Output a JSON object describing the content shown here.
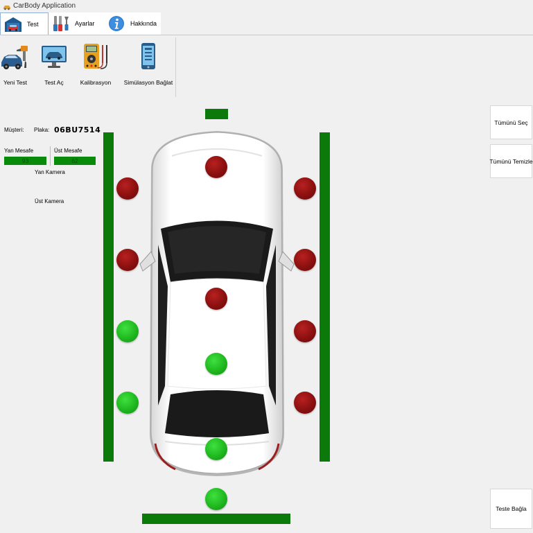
{
  "window": {
    "title": "CarBody Application"
  },
  "tabs": [
    {
      "label": "Test",
      "icon": "garage-icon",
      "active": true
    },
    {
      "label": "Ayarlar",
      "icon": "tools-icon"
    },
    {
      "label": "Hakkında",
      "icon": "info-icon"
    }
  ],
  "toolbar": [
    {
      "label": "Yeni Test",
      "icon": "car-paint-gun-icon"
    },
    {
      "label": "Test Aç",
      "icon": "monitor-car-icon"
    },
    {
      "label": "Kalibrasyon",
      "icon": "multimeter-icon"
    },
    {
      "label": "Simülasyon Bağlat",
      "icon": "smartphone-icon"
    }
  ],
  "info": {
    "customer_label": "Müşteri:",
    "customer_value": "",
    "plate_label": "Plaka:",
    "plate_value": "06BU7514",
    "side_distance_label": "Yan Mesafe",
    "side_distance_value": "93",
    "top_distance_label": "Üst Mesafe",
    "top_distance_value": "62",
    "side_camera_label": "Yan Kamera",
    "top_camera_label": "Üst Kamera"
  },
  "buttons": {
    "select_all": "Tümünü Seç",
    "clear_all": "Tümünü Temizle",
    "connect_test": "Teste Bağla"
  },
  "colors": {
    "sensor_active": "#1fb81f",
    "sensor_inactive": "#8a1010",
    "rail": "#0b7a0b",
    "background": "#f0f0f0"
  },
  "sensors": [
    {
      "id": "left-1",
      "state": "red"
    },
    {
      "id": "left-2",
      "state": "red"
    },
    {
      "id": "left-3",
      "state": "green"
    },
    {
      "id": "left-4",
      "state": "green"
    },
    {
      "id": "right-1",
      "state": "red"
    },
    {
      "id": "right-2",
      "state": "red"
    },
    {
      "id": "right-3",
      "state": "red"
    },
    {
      "id": "right-4",
      "state": "red"
    },
    {
      "id": "top-1",
      "state": "red"
    },
    {
      "id": "top-2",
      "state": "red"
    },
    {
      "id": "top-3",
      "state": "green"
    },
    {
      "id": "top-4",
      "state": "green"
    },
    {
      "id": "rear",
      "state": "green"
    }
  ]
}
